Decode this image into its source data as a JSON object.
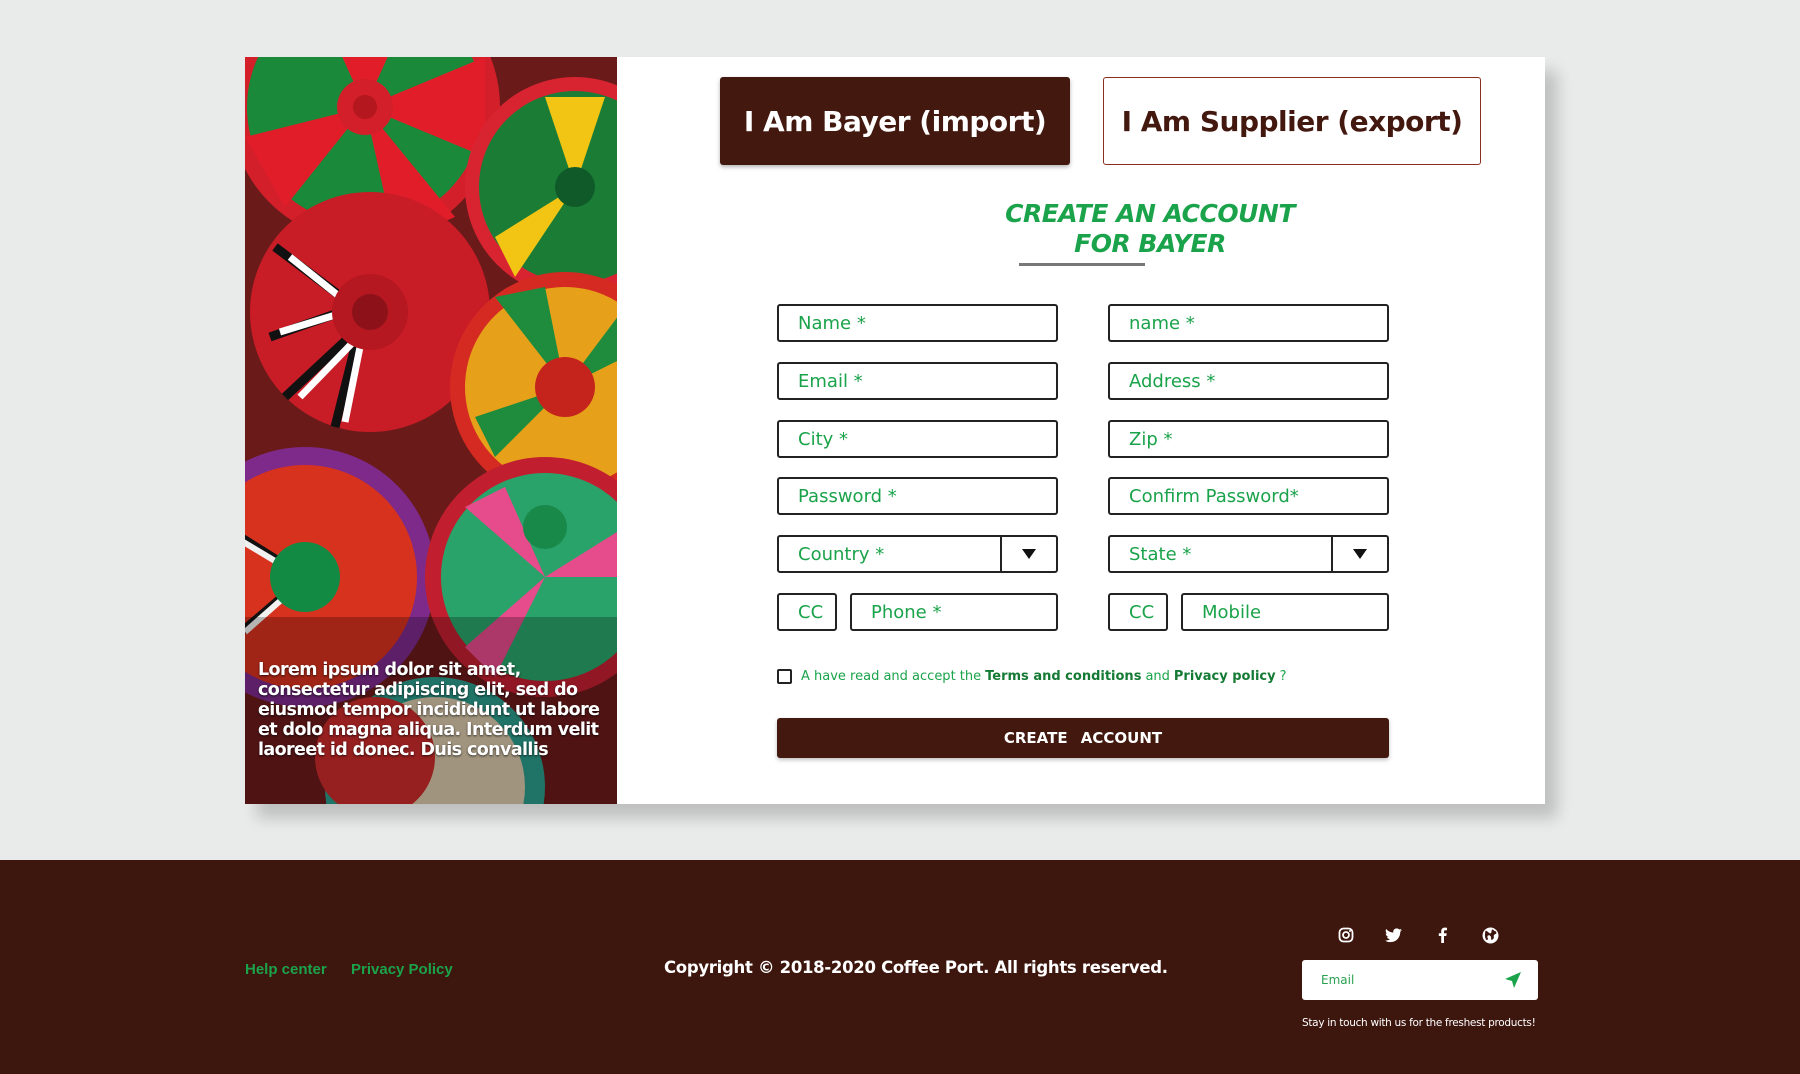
{
  "tabs": {
    "buyer": "I Am Bayer (import)",
    "supplier": "I Am Supplier (export)"
  },
  "heading": {
    "line1": "CREATE AN ACCOUNT",
    "line2": "FOR BAYER"
  },
  "hero": {
    "caption": "Lorem ipsum dolor sit amet, consectetur adipiscing elit, sed do eiusmod tempor incididunt ut labore et dolo magna aliqua. Interdum velit laoreet id donec. Duis convallis"
  },
  "form": {
    "first_name": "Name *",
    "last_name": "name *",
    "email": "Email *",
    "address": "Address *",
    "city": "City *",
    "zip": "Zip *",
    "password": "Password *",
    "confirm_password": "Confirm Password*",
    "country": "Country *",
    "state": "State *",
    "phone_cc": "CC",
    "phone": "Phone *",
    "mobile_cc": "CC",
    "mobile": "Mobile"
  },
  "terms": {
    "prefix": "A have read and accept the",
    "terms_link": "Terms and conditions",
    "and": "and",
    "privacy_link": "Privacy policy",
    "suffix": "?"
  },
  "create_button": "CREATE ACCOUNT",
  "footer": {
    "help_center": "Help center",
    "privacy_policy": "Privacy Policy",
    "copyright": "Copyright © 2018-2020 Coffee Port. All rights reserved.",
    "email_placeholder": "Email",
    "tagline": "Stay in touch with us for the freshest products!"
  },
  "colors": {
    "brand_dark": "#43180f",
    "accent_green": "#1aa34a",
    "footer_bg": "#3d160e"
  },
  "icons": [
    "instagram-icon",
    "twitter-icon",
    "facebook-icon",
    "globe-icon",
    "send-icon",
    "chevron-down-icon"
  ]
}
